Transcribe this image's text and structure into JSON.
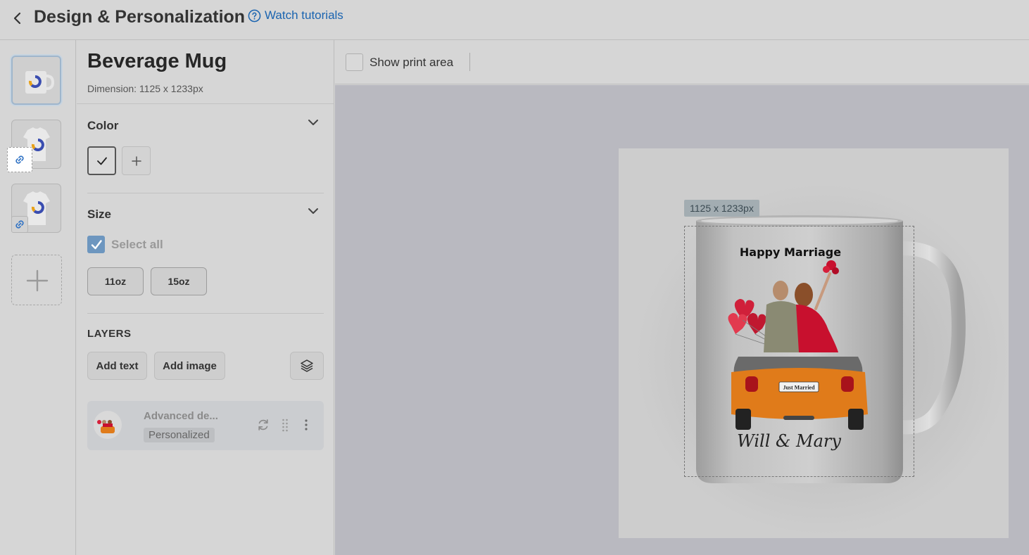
{
  "header": {
    "title": "Design & Personalization",
    "tutorial_label": "Watch tutorials"
  },
  "product": {
    "name": "Beverage Mug",
    "dimension": "Dimension: 1125 x 1233px"
  },
  "color_section": {
    "title": "Color"
  },
  "size_section": {
    "title": "Size",
    "select_all": "Select all",
    "sizes": [
      "11oz",
      "15oz"
    ]
  },
  "layers": {
    "title": "LAYERS",
    "add_text": "Add text",
    "add_image": "Add image",
    "items": [
      {
        "name": "Advanced de...",
        "badge": "Personalized"
      }
    ]
  },
  "toolbar": {
    "show_print_area": "Show print area"
  },
  "canvas": {
    "dimension_tag": "1125 x 1233px",
    "mug_text_top": "Happy Marriage",
    "plate_text": "Just Married",
    "mug_text_bottom": "Will & Mary"
  },
  "colors": {
    "accent": "#1a64b0",
    "checkbox": "#6d96bf",
    "car_orange": "#e07b1a",
    "dress_red": "#c8102e"
  }
}
